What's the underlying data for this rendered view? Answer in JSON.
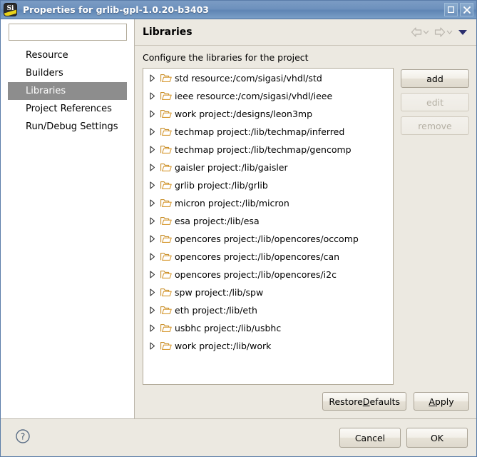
{
  "window": {
    "title": "Properties for grlib-gpl-1.0.20-b3403",
    "app_icon": "sigasi-si-icon",
    "app_icon_text": "Si",
    "maximize_icon": "maximize-icon",
    "close_icon": "close-icon",
    "titlebar_color": "#6e91bd",
    "background_color": "#ece9e1"
  },
  "sidebar": {
    "filter": {
      "value": "",
      "placeholder": ""
    },
    "items": [
      {
        "label": "Resource",
        "selected": false
      },
      {
        "label": "Builders",
        "selected": false
      },
      {
        "label": "Libraries",
        "selected": true
      },
      {
        "label": "Project References",
        "selected": false
      },
      {
        "label": "Run/Debug Settings",
        "selected": false
      }
    ],
    "selection_color": "#8d8d8d"
  },
  "main": {
    "page_title": "Libraries",
    "description": "Configure the libraries for the project",
    "tools": [
      {
        "name": "back-navigation",
        "icon": "left-arrow-icon",
        "dropdown": true,
        "enabled": false
      },
      {
        "name": "forward-navigation",
        "icon": "right-arrow-icon",
        "dropdown": true,
        "enabled": false
      },
      {
        "name": "view-menu",
        "icon": "triangle-down-icon",
        "dropdown": false,
        "enabled": true
      }
    ],
    "tree": {
      "folder_icon": "open-folder-icon",
      "expand_icon": "triangle-right-icon",
      "items": [
        "std resource:/com/sigasi/vhdl/std",
        "ieee resource:/com/sigasi/vhdl/ieee",
        "work project:/designs/leon3mp",
        "techmap project:/lib/techmap/inferred",
        "techmap project:/lib/techmap/gencomp",
        "gaisler project:/lib/gaisler",
        "grlib project:/lib/grlib",
        "micron project:/lib/micron",
        "esa project:/lib/esa",
        "opencores project:/lib/opencores/occomp",
        "opencores project:/lib/opencores/can",
        "opencores project:/lib/opencores/i2c",
        "spw project:/lib/spw",
        "eth project:/lib/eth",
        "usbhc project:/lib/usbhc",
        "work project:/lib/work"
      ]
    },
    "side_buttons": [
      {
        "label": "add",
        "enabled": true
      },
      {
        "label": "edit",
        "enabled": false
      },
      {
        "label": "remove",
        "enabled": false
      }
    ],
    "bottom_buttons": [
      {
        "label_before": "Restore ",
        "mnemonic": "D",
        "label_after": "efaults"
      },
      {
        "label_before": "",
        "mnemonic": "A",
        "label_after": "pply"
      }
    ]
  },
  "footer": {
    "help_icon": "help-question-icon",
    "buttons": [
      {
        "label": "Cancel"
      },
      {
        "label": "OK"
      }
    ]
  }
}
